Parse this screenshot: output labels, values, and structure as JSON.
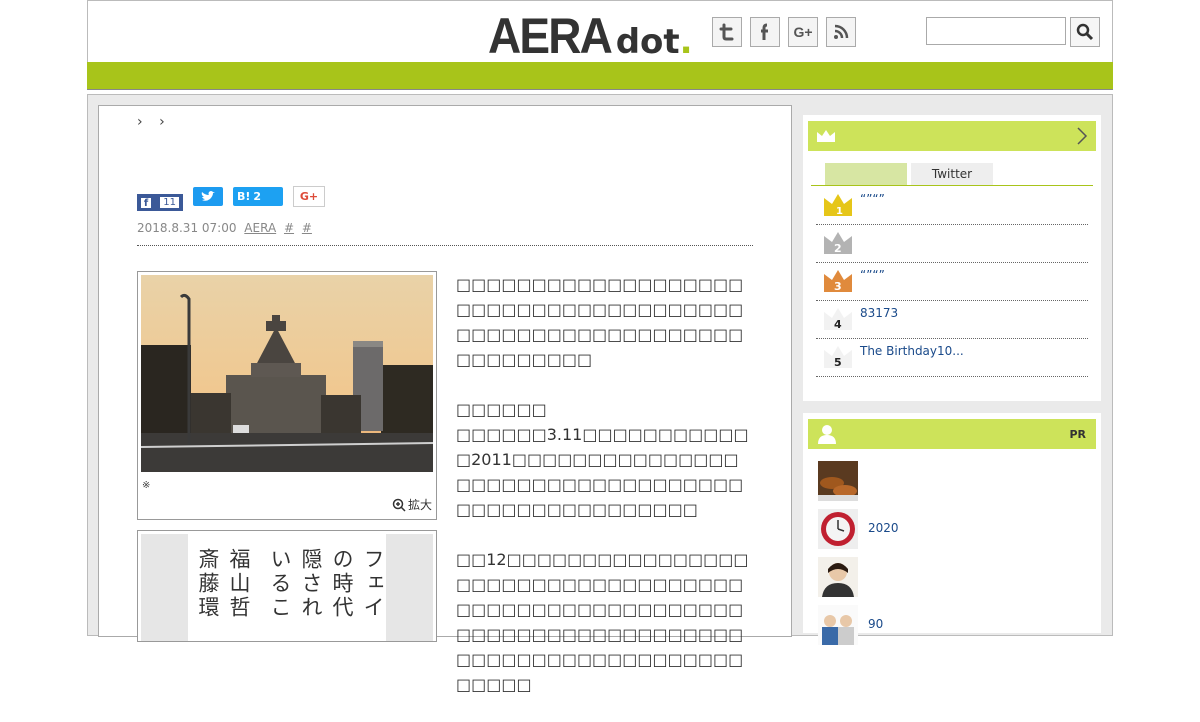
{
  "header": {
    "logo_main": "AERA",
    "logo_sub": "dot",
    "logo_accent": ".",
    "social": [
      {
        "icon": "twitter-icon",
        "glyph": "t"
      },
      {
        "icon": "facebook-icon",
        "glyph": "f"
      },
      {
        "icon": "google-plus-icon",
        "glyph": "G+"
      },
      {
        "icon": "rss-icon",
        "glyph": "rss"
      }
    ],
    "search_placeholder": "",
    "accent_color": "#a8c41a"
  },
  "breadcrumb": {
    "separator_1": "›",
    "separator_2": "›"
  },
  "share": {
    "facebook_count": "11",
    "hatena_label": "B!",
    "hatena_count": "2",
    "google_label": "G+"
  },
  "meta": {
    "date": "2018.8.31 07:00",
    "author": "AERA",
    "tag1": "#",
    "tag2": "#"
  },
  "figure1": {
    "caption_mark": "※",
    "zoom_label": "拡大"
  },
  "figure2": {
    "columns": [
      "フェイ",
      "の時代",
      "隠され",
      "いるこ",
      "福山哲",
      "斎藤環"
    ]
  },
  "article": {
    "paragraphs": [
      "□□□□□□□□□□□□□□□□□□□□□□□□□□□□□□□□□□□□□□□□□□□□□□□□□□□□□□□□□□□□□□□□□□",
      "□□□□□□\n□□□□□□3.11□□□□□□□□□□□□2011□□□□□□□□□□□□□□□□□□□□□□□□□□□□□□□□□□□□□□□□□□□□□□□□□□",
      "□□12□□□□□□□□□□□□□□□□□□□□□□□□□□□□□□□□□□□□□□□□□□□□□□□□□□□□□□□□□□□□□□□□□□□□□□□□□□□□□□□□□□□□□□□□□□□□□□□□□"
    ]
  },
  "ranking": {
    "tab_active": "",
    "tab_twitter": "Twitter",
    "items": [
      {
        "rank": "1",
        "text": "“”“”",
        "color": "#e6c619"
      },
      {
        "rank": "2",
        "text": "",
        "color": "#b3b3b3"
      },
      {
        "rank": "3",
        "text": "“”“”",
        "color": "#e08a3c"
      },
      {
        "rank": "4",
        "text": "83173",
        "color": "#ffffff"
      },
      {
        "rank": "5",
        "text": "The Birthday10...",
        "color": "#ffffff"
      }
    ]
  },
  "pr": {
    "label": "PR",
    "items": [
      {
        "text": ""
      },
      {
        "text": "2020"
      },
      {
        "text": ""
      },
      {
        "text": "90"
      }
    ]
  }
}
